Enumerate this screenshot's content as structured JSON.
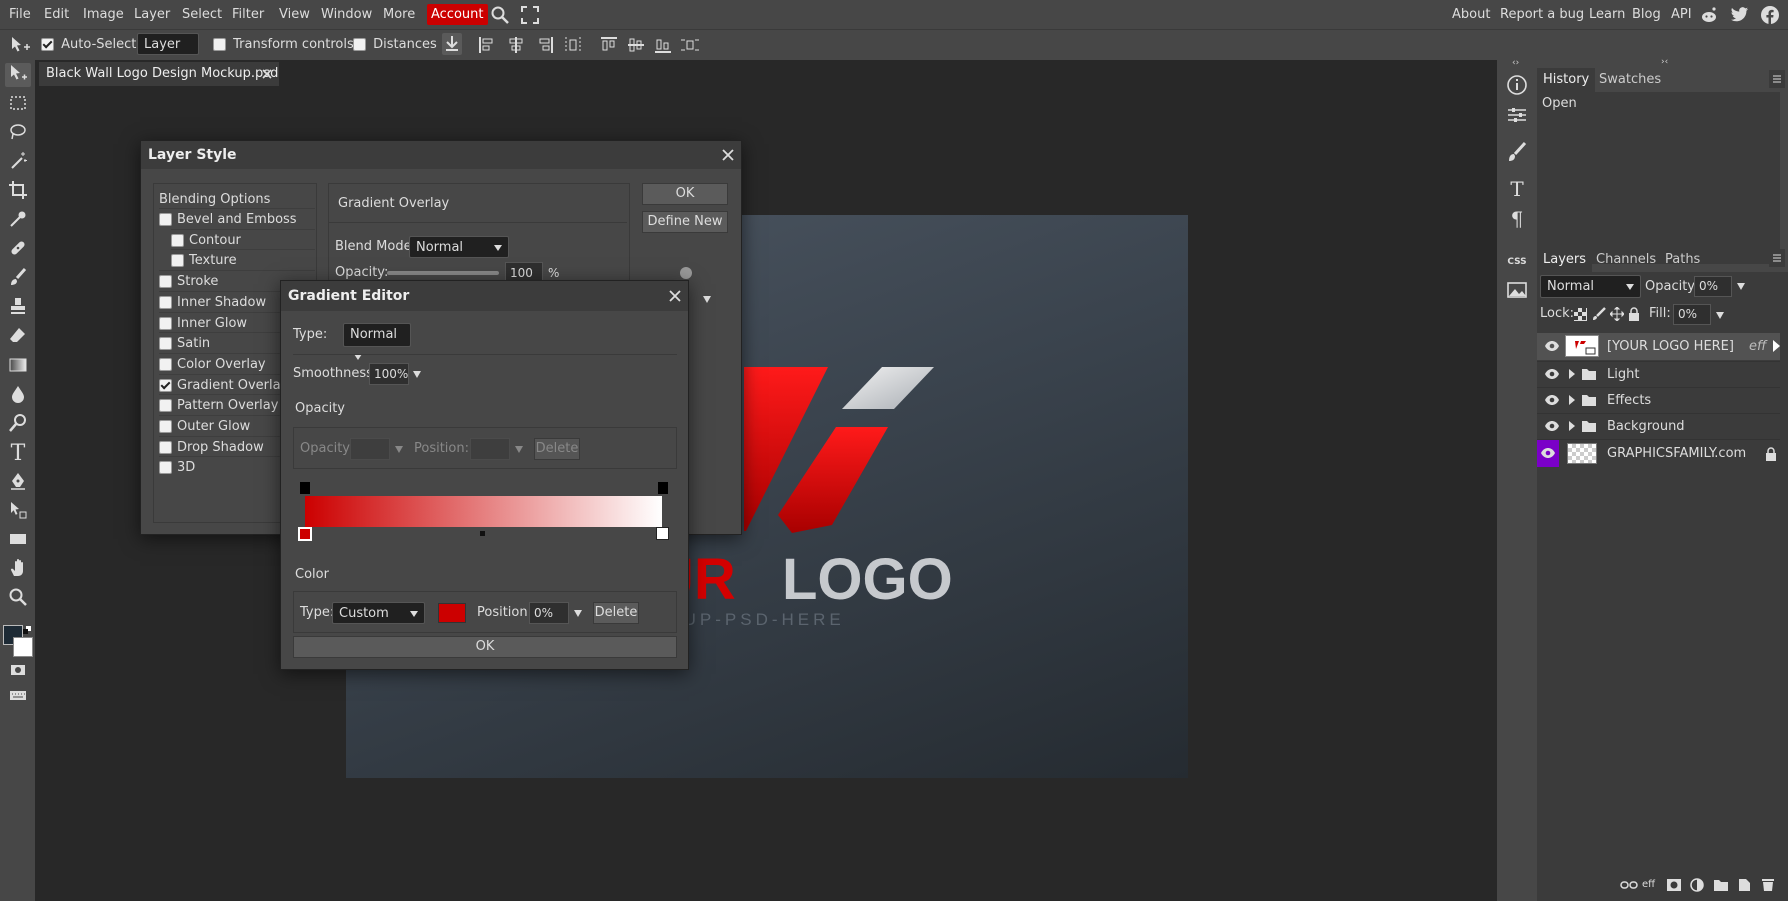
{
  "menubar": {
    "items": [
      "File",
      "Edit",
      "Image",
      "Layer",
      "Select",
      "Filter",
      "View",
      "Window",
      "More"
    ],
    "account": "Account",
    "right_links": [
      "About",
      "Report a bug",
      "Learn",
      "Blog",
      "API"
    ]
  },
  "optionsbar": {
    "auto_select_label": "Auto-Select",
    "auto_select_checked": true,
    "select_target": "Layer",
    "transform_controls_label": "Transform controls",
    "distances_label": "Distances"
  },
  "document": {
    "tab_title": "Black Wall Logo Design Mockup.psd",
    "logo_text": "UR LOGO",
    "logo_red_part": "UR",
    "logo_white_part": "LOGO",
    "subtext": "CKUP-PSD-HERE"
  },
  "layer_style": {
    "title": "Layer Style",
    "blending_options": "Blending Options",
    "options": [
      {
        "label": "Bevel and Emboss",
        "checked": false
      },
      {
        "label": "Contour",
        "checked": false
      },
      {
        "label": "Texture",
        "checked": false
      },
      {
        "label": "Stroke",
        "checked": false
      },
      {
        "label": "Inner Shadow",
        "checked": false
      },
      {
        "label": "Inner Glow",
        "checked": false
      },
      {
        "label": "Satin",
        "checked": false
      },
      {
        "label": "Color Overlay",
        "checked": false
      },
      {
        "label": "Gradient Overlay",
        "checked": true
      },
      {
        "label": "Pattern Overlay",
        "checked": false
      },
      {
        "label": "Outer Glow",
        "checked": false
      },
      {
        "label": "Drop Shadow",
        "checked": false
      },
      {
        "label": "3D",
        "checked": false
      }
    ],
    "section_title": "Gradient Overlay",
    "blend_mode_label": "Blend Mode:",
    "blend_mode_value": "Normal",
    "opacity_label": "Opacity:",
    "opacity_value": "100",
    "opacity_unit": "%",
    "opacity_level": 1.0,
    "ok_label": "OK",
    "define_new_label": "Define New"
  },
  "gradient_editor": {
    "title": "Gradient Editor",
    "type_label": "Type:",
    "type_value": "Normal",
    "smoothness_label": "Smoothness:",
    "smoothness_value": "100%",
    "opacity_section": "Opacity",
    "opacity_field_label": "Opacity:",
    "opacity_field_value": "",
    "position_field_label": "Position:",
    "position_field_value": "",
    "delete_label": "Delete",
    "color_section": "Color",
    "color_type_label": "Type:",
    "color_type_value": "Custom",
    "color_swatch": "#cc0000",
    "color_position_label": "Position:",
    "color_position_value": "0%",
    "color_delete_label": "Delete",
    "ok_label": "OK",
    "gradient_start": "#cc0000",
    "gradient_end": "#ffffff"
  },
  "history_panel": {
    "tabs": [
      "History",
      "Swatches"
    ],
    "items": [
      "Open"
    ]
  },
  "layers_panel": {
    "tabs": [
      "Layers",
      "Channels",
      "Paths"
    ],
    "blend_mode": "Normal",
    "opacity_label": "Opacity:",
    "opacity_value": "0%",
    "lock_label": "Lock:",
    "fill_label": "Fill:",
    "fill_value": "0%",
    "layers": [
      {
        "name": "[YOUR LOGO HERE]",
        "type": "smart",
        "fx": "eff"
      },
      {
        "name": "Light",
        "type": "folder"
      },
      {
        "name": "Effects",
        "type": "folder"
      },
      {
        "name": "Background",
        "type": "folder"
      },
      {
        "name": "GRAPHICSFAMILY.com",
        "type": "layer",
        "locked": true
      }
    ]
  },
  "colors": {
    "accent_red": "#cc0000",
    "panel_bg": "#474747",
    "workspace_bg": "#282828",
    "foreground_swatch": "#1d2a35",
    "background_swatch": "#ffffff",
    "layer_eye_highlight": "#7a00c8"
  }
}
